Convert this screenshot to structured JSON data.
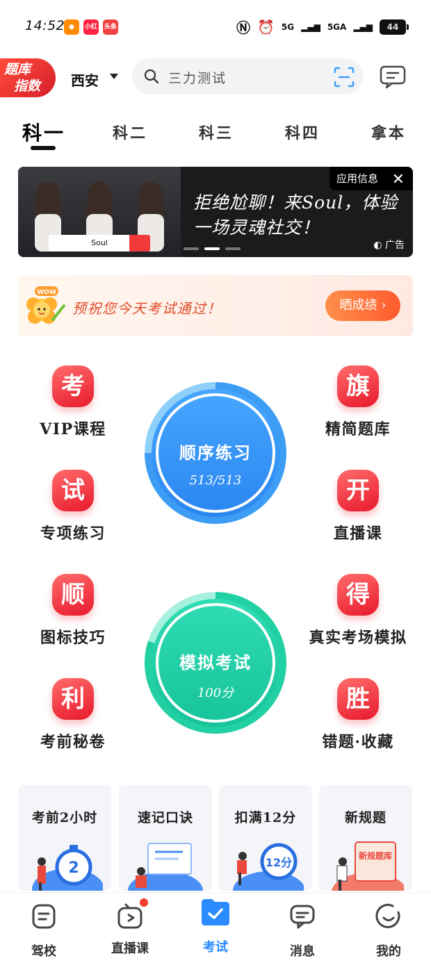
{
  "status_bar": {
    "time": "14:52",
    "apps": [
      "小红书",
      "头条"
    ],
    "network1": "5G",
    "network2": "5GA",
    "battery": "44"
  },
  "header": {
    "index_badge_line1": "题库",
    "index_badge_line2": "指数",
    "city": "西安",
    "search_placeholder": "三力测试"
  },
  "tabs": [
    {
      "label": "科一",
      "active": true
    },
    {
      "label": "科二",
      "active": false
    },
    {
      "label": "科三",
      "active": false
    },
    {
      "label": "科四",
      "active": false
    },
    {
      "label": "拿本",
      "active": false
    }
  ],
  "ad": {
    "info_label": "应用信息",
    "close": "✕",
    "headline": "拒绝尬聊！来Soul，体验一场灵魂社交！",
    "soul_label": "Soul",
    "tag": "广告"
  },
  "wish": {
    "badge": "WOW",
    "text": "预祝您今天考试通过！",
    "button": "晒成绩 ›"
  },
  "menu": {
    "vip": {
      "icon_char": "考",
      "label": "VIP课程"
    },
    "special": {
      "icon_char": "试",
      "label": "专项练习"
    },
    "icon_skill": {
      "icon_char": "顺",
      "label": "图标技巧"
    },
    "secret": {
      "icon_char": "利",
      "label": "考前秘卷"
    },
    "bank": {
      "icon_char": "旗",
      "label": "精简题库"
    },
    "live": {
      "icon_char": "开",
      "label": "直播课"
    },
    "sim": {
      "icon_char": "得",
      "label": "真实考场模拟"
    },
    "wrong": {
      "icon_char": "胜",
      "label": "错题·收藏"
    }
  },
  "practice": {
    "title": "顺序练习",
    "progress": "513/513"
  },
  "exam": {
    "title": "模拟考试",
    "score": "100分"
  },
  "cards": [
    {
      "title": "考前2小时",
      "art_text": "2"
    },
    {
      "title": "速记口诀",
      "art_text": ""
    },
    {
      "title": "扣满12分",
      "art_text": "12分"
    },
    {
      "title": "新规题",
      "art_text": "新规题库"
    }
  ],
  "bottom_nav": [
    {
      "label": "驾校",
      "active": false
    },
    {
      "label": "直播课",
      "active": false
    },
    {
      "label": "考试",
      "active": true
    },
    {
      "label": "消息",
      "active": false
    },
    {
      "label": "我的",
      "active": false
    }
  ],
  "colors": {
    "primary_blue": "#2b8cff",
    "accent_red": "#e8192c",
    "teal": "#1fd4a8"
  }
}
